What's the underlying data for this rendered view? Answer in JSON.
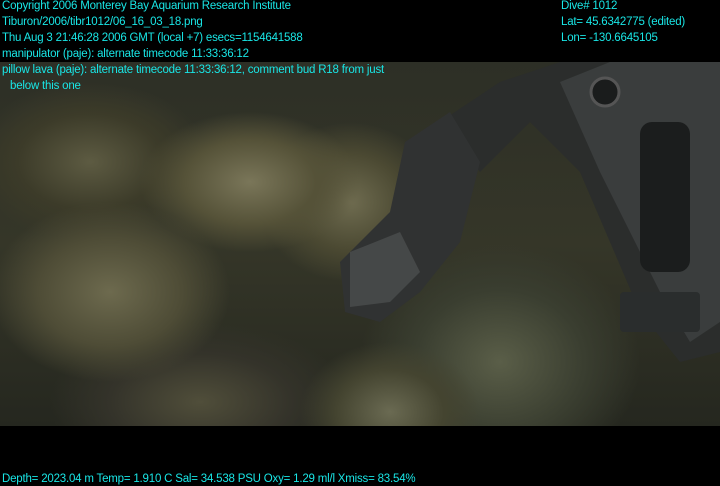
{
  "overlay_left": {
    "copyright": "Copyright 2006 Monterey Bay Aquarium Research Institute",
    "file": "Tiburon/2006/tibr1012/06_16_03_18.png",
    "time": "Thu Aug  3 21:46:28 2006 GMT (local +7)  esecs=1154641588",
    "annotation_1": "manipulator (paje): alternate timecode 11:33:36:12",
    "annotation_2": "pillow lava (paje): alternate timecode 11:33:36:12, comment bud R18 from just",
    "annotation_2_cont": "below this one"
  },
  "overlay_right": {
    "dive": "Dive# 1012",
    "lat": "Lat= 45.6342775 (edited)",
    "lon": "Lon= -130.6645105"
  },
  "overlay_bottom": {
    "sensors": "Depth= 2023.04 m  Temp= 1.910 C  Sal= 34.538 PSU  Oxy= 1.29 ml/l  Xmiss= 83.54%"
  },
  "colors": {
    "overlay_text": "#19e6e6"
  }
}
